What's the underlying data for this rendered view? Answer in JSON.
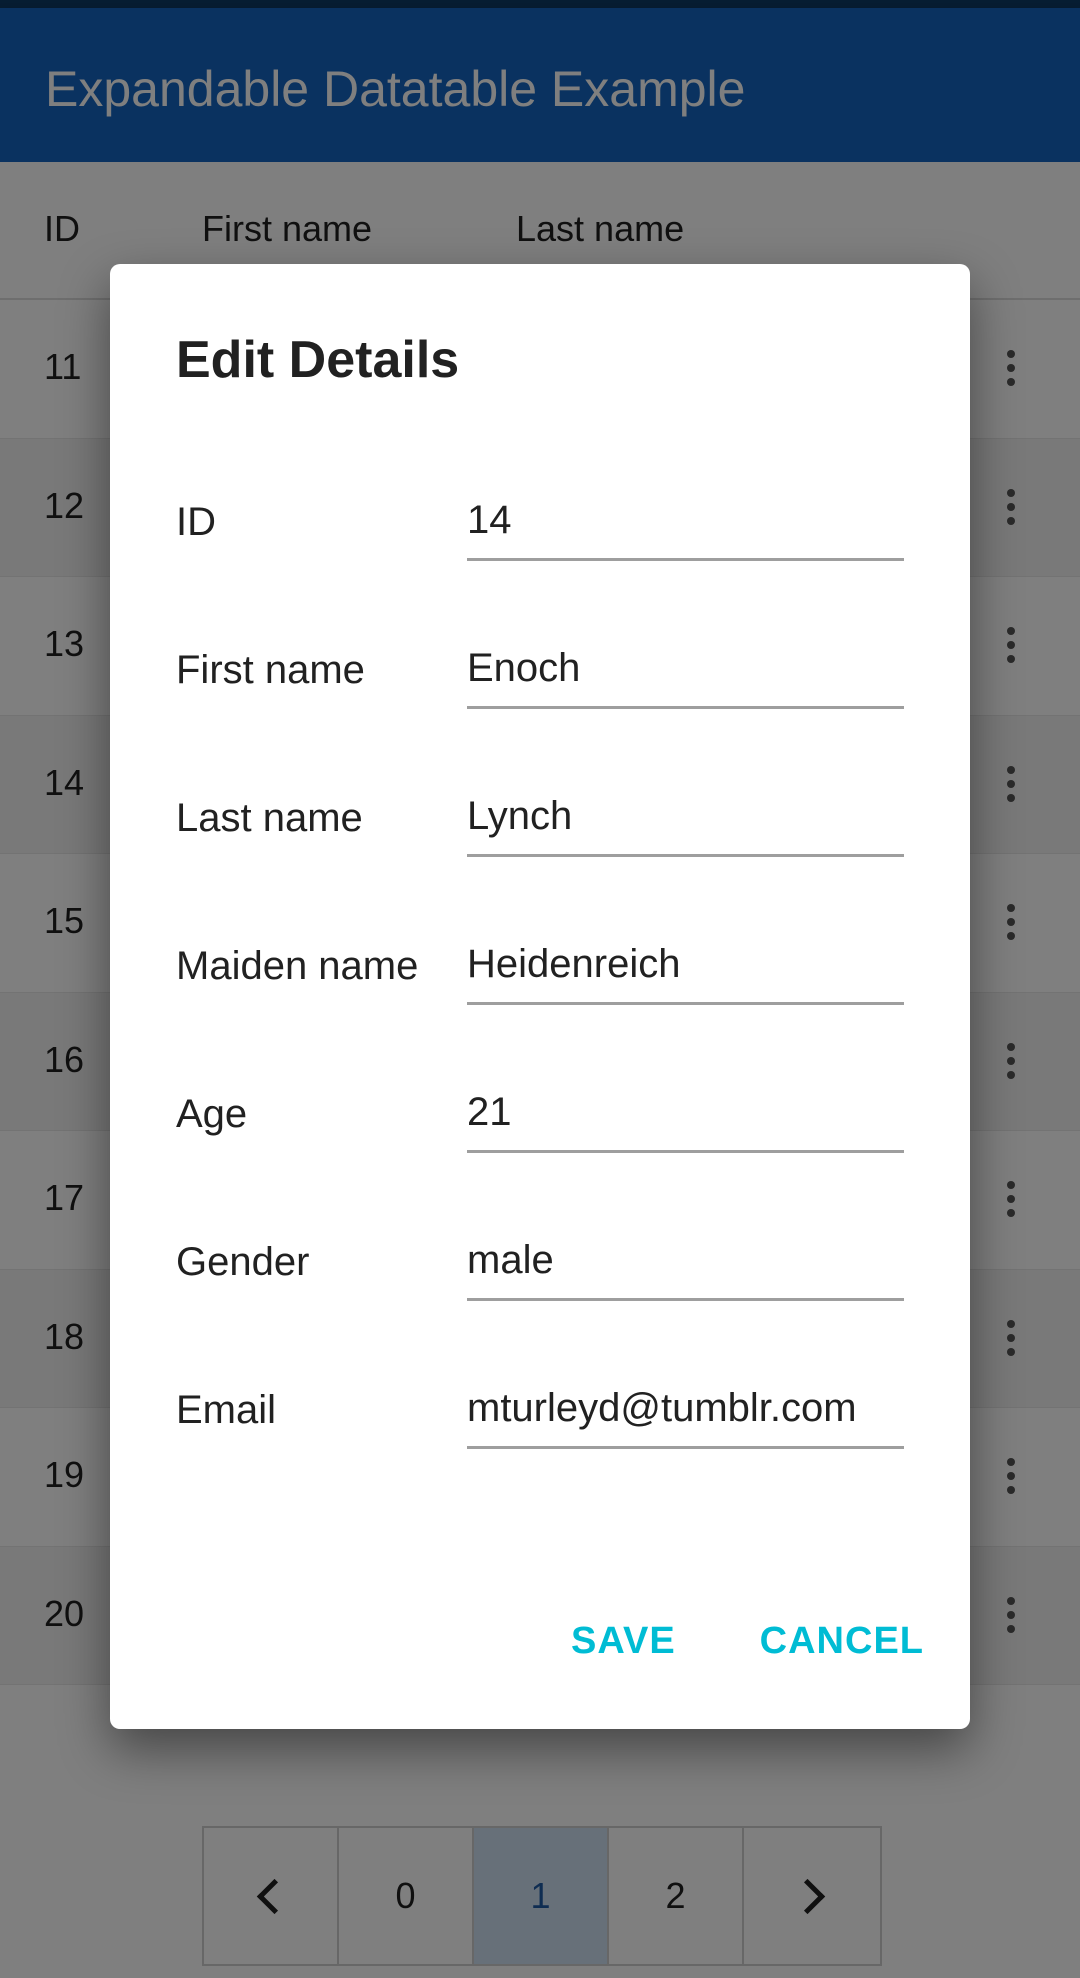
{
  "app": {
    "title": "Expandable Datatable Example"
  },
  "table": {
    "headers": [
      "ID",
      "First name",
      "Last name"
    ],
    "rows": [
      {
        "id": "11"
      },
      {
        "id": "12"
      },
      {
        "id": "13"
      },
      {
        "id": "14"
      },
      {
        "id": "15"
      },
      {
        "id": "16"
      },
      {
        "id": "17"
      },
      {
        "id": "18"
      },
      {
        "id": "19"
      },
      {
        "id": "20"
      }
    ],
    "row_action_icon": "more-vert-icon"
  },
  "pagination": {
    "prev_icon": "chevron-left-icon",
    "pages": [
      "0",
      "1",
      "2"
    ],
    "active_page": "1",
    "next_icon": "chevron-right-icon",
    "active_color": "#1e5ba5"
  },
  "dialog": {
    "title": "Edit Details",
    "fields": [
      {
        "label": "ID",
        "value": "14"
      },
      {
        "label": "First name",
        "value": "Enoch"
      },
      {
        "label": "Last name",
        "value": "Lynch"
      },
      {
        "label": "Maiden name",
        "value": "Heidenreich"
      },
      {
        "label": "Age",
        "value": "21"
      },
      {
        "label": "Gender",
        "value": "male"
      },
      {
        "label": "Email",
        "value": "mturleyd@tumblr.com"
      }
    ],
    "save_label": "SAVE",
    "cancel_label": "CANCEL",
    "accent_color": "#00bcd4"
  },
  "colors": {
    "app_bar": "#1565c0",
    "scrim_opacity": 0.5
  }
}
